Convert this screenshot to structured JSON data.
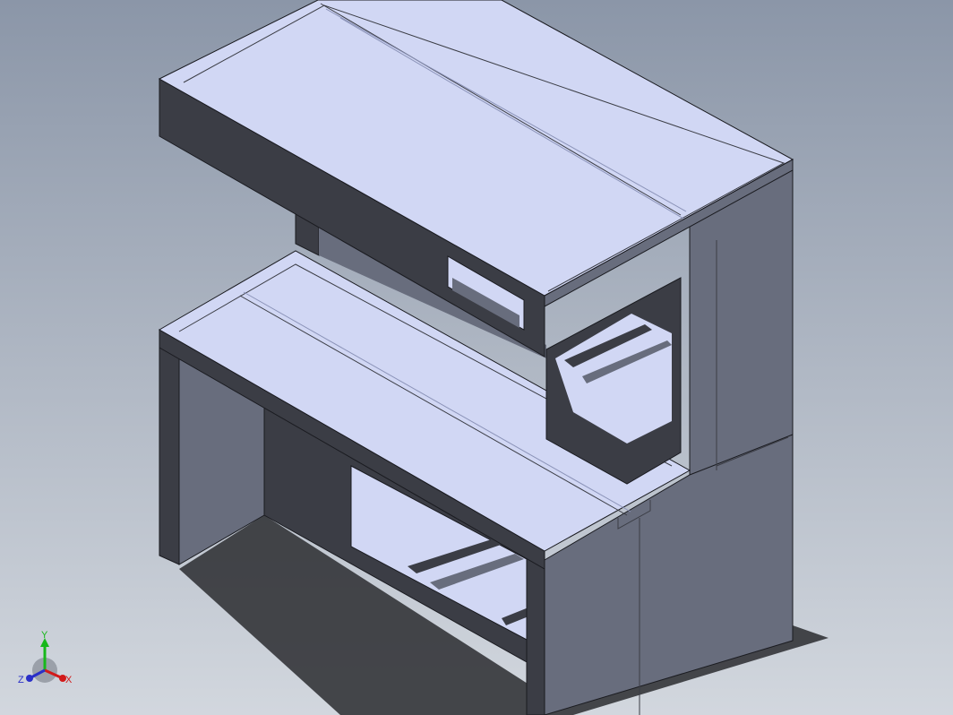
{
  "viewport": {
    "background_top": "#8b96a8",
    "background_bottom": "#d2d7de"
  },
  "model": {
    "face_light": "#d1d7f4",
    "face_mid": "#686d7d",
    "face_dark": "#3b3d45",
    "edge": "#1a1b20"
  },
  "triad": {
    "x_label": "X",
    "y_label": "Y",
    "z_label": "Z",
    "x_color": "#d21a1a",
    "y_color": "#17b81a",
    "z_color": "#2a2fc8"
  }
}
